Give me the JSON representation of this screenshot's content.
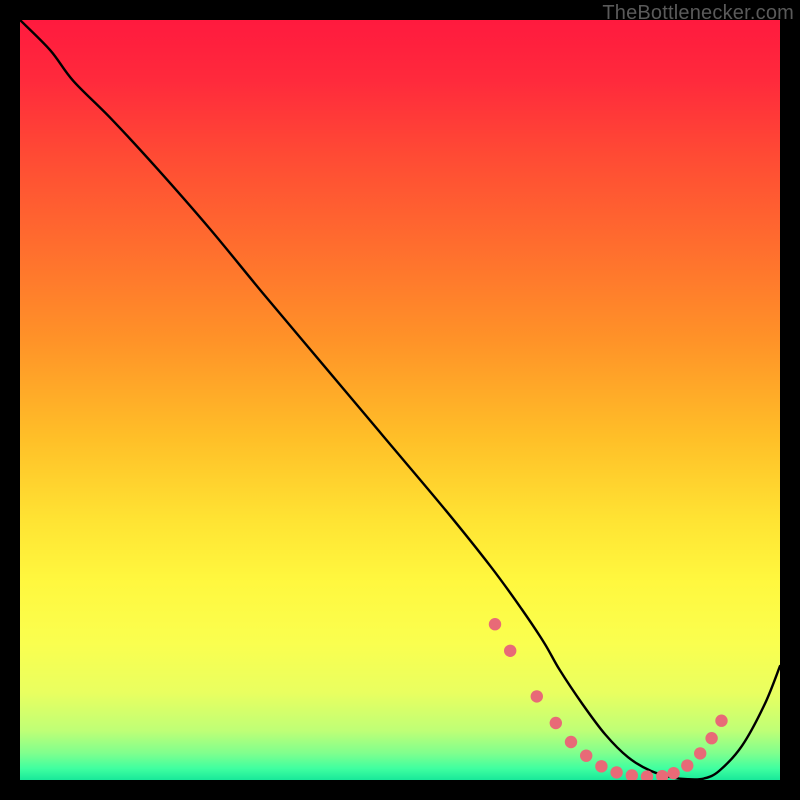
{
  "credit": "TheBottlenecker.com",
  "gradient_stops": [
    {
      "offset": 0.0,
      "color": "#ff1a3e"
    },
    {
      "offset": 0.08,
      "color": "#ff2a3c"
    },
    {
      "offset": 0.18,
      "color": "#ff4b34"
    },
    {
      "offset": 0.3,
      "color": "#ff6e2e"
    },
    {
      "offset": 0.42,
      "color": "#ff9228"
    },
    {
      "offset": 0.55,
      "color": "#ffbf28"
    },
    {
      "offset": 0.66,
      "color": "#ffe433"
    },
    {
      "offset": 0.74,
      "color": "#fff83f"
    },
    {
      "offset": 0.82,
      "color": "#faff4f"
    },
    {
      "offset": 0.885,
      "color": "#e9ff60"
    },
    {
      "offset": 0.935,
      "color": "#bfff76"
    },
    {
      "offset": 0.965,
      "color": "#7fff8e"
    },
    {
      "offset": 0.985,
      "color": "#3fffa0"
    },
    {
      "offset": 1.0,
      "color": "#18e89a"
    }
  ],
  "marker_color": "#e86a77",
  "chart_data": {
    "type": "line",
    "title": "",
    "xlabel": "",
    "ylabel": "",
    "xlim": [
      0,
      100
    ],
    "ylim": [
      0,
      100
    ],
    "grid": false,
    "series": [
      {
        "name": "curve",
        "x": [
          0,
          4,
          7,
          12,
          18,
          25,
          32,
          40,
          48,
          56,
          62,
          66,
          69,
          71,
          74,
          77,
          80,
          83,
          86,
          88,
          90,
          92,
          95,
          98,
          100
        ],
        "y": [
          100,
          96,
          92,
          87,
          80.5,
          72.5,
          64,
          54.5,
          45,
          35.5,
          28,
          22.5,
          18,
          14.5,
          10,
          6,
          3,
          1.2,
          0.3,
          0.1,
          0.2,
          1.2,
          4.5,
          10,
          15
        ]
      }
    ],
    "markers": {
      "name": "dots",
      "color": "#e86a77",
      "x": [
        62.5,
        64.5,
        68.0,
        70.5,
        72.5,
        74.5,
        76.5,
        78.5,
        80.5,
        82.5,
        84.5,
        86.0,
        87.8,
        89.5,
        91.0,
        92.3
      ],
      "y": [
        20.5,
        17.0,
        11.0,
        7.5,
        5.0,
        3.2,
        1.8,
        1.0,
        0.6,
        0.45,
        0.5,
        0.9,
        1.9,
        3.5,
        5.5,
        7.8
      ]
    }
  }
}
